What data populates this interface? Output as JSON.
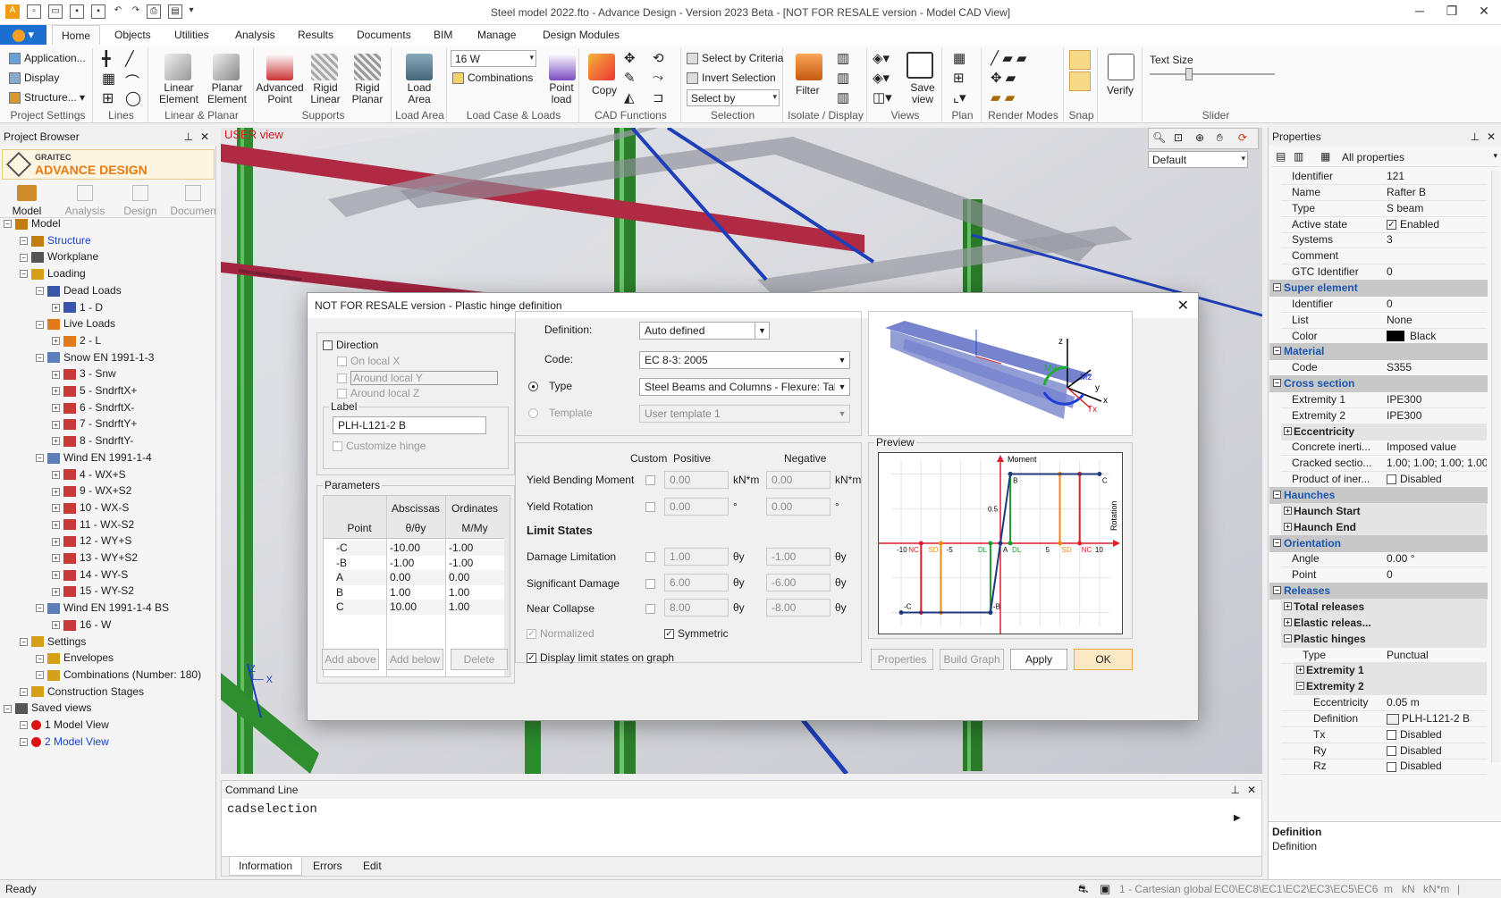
{
  "title_bar": {
    "title": "Steel model 2022.fto - Advance Design - Version 2023 Beta - [NOT FOR RESALE version - Model CAD View]"
  },
  "menu_tabs": [
    "Home",
    "Objects",
    "Utilities",
    "Analysis",
    "Results",
    "Documents",
    "BIM",
    "Manage",
    "Design Modules"
  ],
  "ribbon": {
    "project_settings": {
      "items": [
        "Application...",
        "Display",
        "Structure..."
      ],
      "label": "Project Settings"
    },
    "lines": {
      "label": "Lines"
    },
    "linear_planar": {
      "linear": "Linear Element",
      "planar": "Planar Element",
      "label": "Linear & Planar"
    },
    "supports": {
      "advanced": "Advanced Point",
      "rigid_linear": "Rigid Linear",
      "rigid_planar": "Rigid Planar",
      "label": "Supports"
    },
    "load_area": {
      "btn": "Load Area",
      "label": "Load Area"
    },
    "load_case": {
      "combo": "16 W",
      "combinations": "Combinations",
      "point_load": "Point load",
      "label": "Load Case & Loads"
    },
    "cad": {
      "copy": "Copy",
      "label": "CAD Functions"
    },
    "selection": {
      "by_criteria": "Select by Criteria",
      "invert": "Invert Selection",
      "select_by": "Select by",
      "label": "Selection"
    },
    "isolate": {
      "filter": "Filter",
      "label": "Isolate / Display"
    },
    "views": {
      "save_view": "Save view",
      "label": "Views"
    },
    "plan": {
      "label": "Plan"
    },
    "render": {
      "label": "Render Modes"
    },
    "snap": {
      "label": "Snap"
    },
    "verify": {
      "btn": "Verify"
    },
    "slider": {
      "text_size": "Text Size",
      "label": "Slider",
      "value": 0.3
    }
  },
  "project_browser": {
    "header": "Project Browser",
    "brand_top": "GRAITEC",
    "brand": "ADVANCE DESIGN",
    "modes": [
      "Model",
      "Analysis",
      "Design",
      "Documen"
    ],
    "tree": [
      {
        "t": "Model",
        "l": 0,
        "c": "#c27d0e"
      },
      {
        "t": "Structure",
        "l": 1,
        "c": "#c27d0e",
        "blue": true
      },
      {
        "t": "Workplane",
        "l": 1,
        "c": "#555"
      },
      {
        "t": "Loading",
        "l": 1,
        "c": "#d4a017"
      },
      {
        "t": "Dead Loads",
        "l": 2,
        "c": "#3a56a8"
      },
      {
        "t": "1 - D",
        "l": 3,
        "c": "#3a56a8"
      },
      {
        "t": "Live Loads",
        "l": 2,
        "c": "#e07a1a"
      },
      {
        "t": "2 - L",
        "l": 3,
        "c": "#e07a1a"
      },
      {
        "t": "Snow EN 1991-1-3",
        "l": 2,
        "c": "#5d7fb8"
      },
      {
        "t": "3 - Snw",
        "l": 3,
        "c": "#c83a3a"
      },
      {
        "t": "5 - SndrftX+",
        "l": 3,
        "c": "#c83a3a"
      },
      {
        "t": "6 - SndrftX-",
        "l": 3,
        "c": "#c83a3a"
      },
      {
        "t": "7 - SndrftY+",
        "l": 3,
        "c": "#c83a3a"
      },
      {
        "t": "8 - SndrftY-",
        "l": 3,
        "c": "#c83a3a"
      },
      {
        "t": "Wind EN 1991-1-4",
        "l": 2,
        "c": "#5d7fb8"
      },
      {
        "t": "4 - WX+S",
        "l": 3,
        "c": "#c83a3a"
      },
      {
        "t": "9 - WX+S2",
        "l": 3,
        "c": "#c83a3a"
      },
      {
        "t": "10 - WX-S",
        "l": 3,
        "c": "#c83a3a"
      },
      {
        "t": "11 - WX-S2",
        "l": 3,
        "c": "#c83a3a"
      },
      {
        "t": "12 - WY+S",
        "l": 3,
        "c": "#c83a3a"
      },
      {
        "t": "13 - WY+S2",
        "l": 3,
        "c": "#c83a3a"
      },
      {
        "t": "14 - WY-S",
        "l": 3,
        "c": "#c83a3a"
      },
      {
        "t": "15 - WY-S2",
        "l": 3,
        "c": "#c83a3a"
      },
      {
        "t": "Wind EN 1991-1-4 BS",
        "l": 2,
        "c": "#5d7fb8"
      },
      {
        "t": "16 - W",
        "l": 3,
        "c": "#c83a3a"
      },
      {
        "t": "Settings",
        "l": 1,
        "c": "#d4a017"
      },
      {
        "t": "Envelopes",
        "l": 2,
        "c": "#d4a017"
      },
      {
        "t": "Combinations (Number: 180)",
        "l": 2,
        "c": "#d4a017"
      },
      {
        "t": "Construction Stages",
        "l": 1,
        "c": "#d4a017"
      },
      {
        "t": "Saved views",
        "l": 0,
        "c": "#555"
      },
      {
        "t": "1 Model View",
        "l": 1,
        "c": "#d11"
      },
      {
        "t": "2 Model View",
        "l": 1,
        "c": "#d11",
        "blue": true
      }
    ]
  },
  "viewport": {
    "user_label": "USER view"
  },
  "command_line": {
    "header": "Command Line",
    "text": "cadselection",
    "tabs": [
      "Information",
      "Errors",
      "Edit"
    ]
  },
  "properties": {
    "header": "Properties",
    "filter": "All properties",
    "view_combo": "Default",
    "rows": [
      {
        "k": "Identifier",
        "v": "121"
      },
      {
        "k": "Name",
        "v": "Rafter B"
      },
      {
        "k": "Type",
        "v": "S beam"
      },
      {
        "k": "Active state",
        "v": "Enabled",
        "cb": true
      },
      {
        "k": "Systems",
        "v": "3"
      },
      {
        "k": "Comment",
        "v": ""
      },
      {
        "k": "GTC Identifier",
        "v": "0"
      },
      {
        "sec": "Super element"
      },
      {
        "k": "Identifier",
        "v": "0"
      },
      {
        "k": "List",
        "v": "None"
      },
      {
        "k": "Color",
        "v": "Black",
        "sw": "#000000"
      },
      {
        "sec": "Material"
      },
      {
        "k": "Code",
        "v": "S355"
      },
      {
        "sec": "Cross section"
      },
      {
        "k": "Extremity 1",
        "v": "IPE300"
      },
      {
        "k": "Extremity 2",
        "v": "IPE300"
      },
      {
        "sub": "Eccentricity"
      },
      {
        "k": "Concrete inerti...",
        "v": "Imposed value"
      },
      {
        "k": "Cracked sectio...",
        "v": "1.00; 1.00; 1.00; 1.00"
      },
      {
        "k": "Product of iner...",
        "v": "Disabled",
        "cb": false
      },
      {
        "sec": "Haunches"
      },
      {
        "sub": "Haunch Start"
      },
      {
        "sub": "Haunch End"
      },
      {
        "sec": "Orientation"
      },
      {
        "k": "Angle",
        "v": "0.00 °"
      },
      {
        "k": "Point",
        "v": "0"
      },
      {
        "sec": "Releases"
      },
      {
        "sub": "Total releases"
      },
      {
        "sub": "Elastic releas..."
      },
      {
        "sub": "Plastic hinges",
        "open": true
      },
      {
        "k": "Type",
        "v": "Punctual",
        "ind": 1
      },
      {
        "sub2": "Extremity 1"
      },
      {
        "sub2": "Extremity 2",
        "open": true
      },
      {
        "k": "Eccentricity",
        "v": "0.05 m",
        "ind": 2
      },
      {
        "k": "Definition",
        "v": "PLH-L121-2 B",
        "ind": 2,
        "ico": true
      },
      {
        "k": "Tx",
        "v": "Disabled",
        "ind": 2,
        "cb": false
      },
      {
        "k": "Ry",
        "v": "Disabled",
        "ind": 2,
        "cb": false
      },
      {
        "k": "Rz",
        "v": "Disabled",
        "ind": 2,
        "cb": false
      }
    ],
    "desc_title": "Definition",
    "desc_text": "Definition"
  },
  "dialog": {
    "title": "NOT FOR RESALE version - Plastic hinge definition",
    "direction": "Direction",
    "on_local_x": "On local X",
    "around_local_y": "Around local Y",
    "around_local_z": "Around local Z",
    "label_group": "Label",
    "label_value": "PLH-L121-2 B",
    "customize": "Customize hinge",
    "params_group": "Parameters",
    "col_abscissas": "Abscissas",
    "col_ordinates": "Ordinates",
    "col_point": "Point",
    "col_theta": "θ/θy",
    "col_mmy": "M/My",
    "params": [
      {
        "p": "-C",
        "a": "-10.00",
        "o": "-1.00"
      },
      {
        "p": "-B",
        "a": "-1.00",
        "o": "-1.00"
      },
      {
        "p": "A",
        "a": "0.00",
        "o": "0.00"
      },
      {
        "p": "B",
        "a": "1.00",
        "o": "1.00"
      },
      {
        "p": "C",
        "a": "10.00",
        "o": "1.00"
      }
    ],
    "btn_add_above": "Add above",
    "btn_add_below": "Add below",
    "btn_delete": "Delete",
    "definition_lbl": "Definition:",
    "definition_val": "Auto defined",
    "code_lbl": "Code:",
    "code_val": "EC 8-3: 2005",
    "type_lbl": "Type",
    "type_val": "Steel Beams and Columns - Flexure: Table B.1;",
    "template_lbl": "Template",
    "template_val": "User template 1",
    "col_custom": "Custom",
    "col_positive": "Positive",
    "col_negative": "Negative",
    "yield_moment": "Yield Bending Moment",
    "ym_pos": "0.00",
    "ym_neg": "0.00",
    "unit_knm": "kN*m",
    "yield_rotation": "Yield Rotation",
    "yr_pos": "0.00",
    "yr_neg": "0.00",
    "unit_deg": "°",
    "limit_states": "Limit States",
    "damage": "Damage Limitation",
    "dl_pos": "1.00",
    "dl_neg": "-1.00",
    "significant": "Significant Damage",
    "sd_pos": "6.00",
    "sd_neg": "-6.00",
    "collapse": "Near Collapse",
    "nc_pos": "8.00",
    "nc_neg": "-8.00",
    "unit_theta": "θy",
    "normalized": "Normalized",
    "symmetric": "Symmetric",
    "display_limits": "Display limit states on graph",
    "preview": "Preview",
    "btn_properties": "Properties",
    "btn_build_graph": "Build Graph",
    "btn_apply": "Apply",
    "btn_ok": "OK"
  },
  "status": {
    "left": "Ready",
    "coord": "1 - Cartesian global",
    "codes": "EC0\\EC8\\EC1\\EC2\\EC3\\EC5\\EC6",
    "units": [
      "m",
      "kN",
      "kN*m",
      "|"
    ]
  },
  "chart_data": {
    "type": "line",
    "x": [
      -10,
      -1,
      0,
      1,
      10
    ],
    "y": [
      -1,
      -1,
      0,
      1,
      1
    ],
    "xlabel": "Rotation",
    "ylabel": "Moment",
    "xlim": [
      -11,
      11
    ],
    "ylim": [
      -1.2,
      1.2
    ],
    "point_labels": [
      "-C",
      "-B",
      "A",
      "B",
      "C"
    ],
    "limit_states": [
      {
        "name": "DL",
        "x": 1,
        "color": "#1b9e2f"
      },
      {
        "name": "SD",
        "x": 6,
        "color": "#f08a12"
      },
      {
        "name": "NC",
        "x": 8,
        "color": "#e11d2a"
      },
      {
        "name": "DL",
        "x": -1,
        "color": "#1b9e2f"
      },
      {
        "name": "SD",
        "x": -6,
        "color": "#f08a12"
      },
      {
        "name": "NC",
        "x": -8,
        "color": "#e11d2a"
      }
    ],
    "x_ticks": [
      -10,
      -5,
      5,
      10
    ],
    "y_ticks": [
      0.5
    ]
  }
}
